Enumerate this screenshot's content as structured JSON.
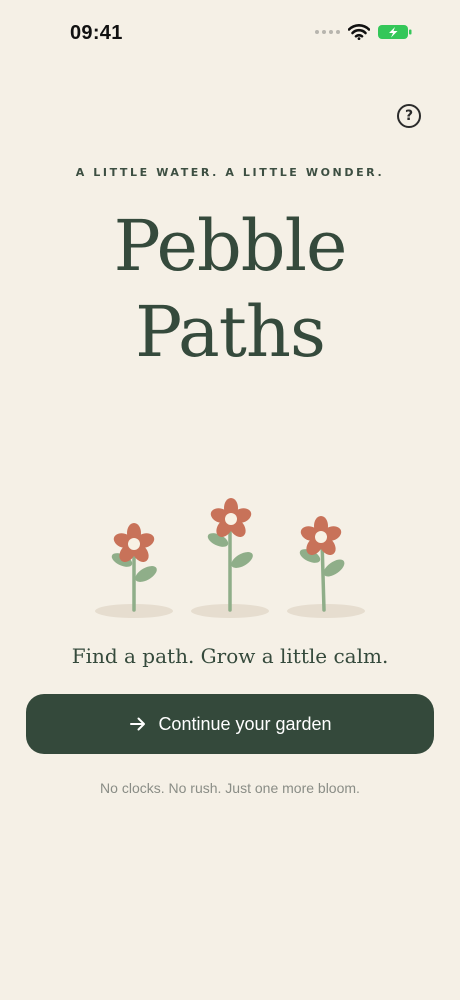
{
  "status_bar": {
    "time": "09:41",
    "icons": [
      "signal-dots-icon",
      "wifi-icon",
      "battery-charging-icon"
    ],
    "battery_color": "#34c759"
  },
  "help": {
    "label": "?"
  },
  "tagline": "A LITTLE WATER. A LITTLE WONDER.",
  "title": {
    "line1": "Pebble",
    "line2": "Paths"
  },
  "subtitle": "Find a path. Grow a little calm.",
  "primary_button": {
    "label": "Continue your garden",
    "icon": "arrow-right-icon"
  },
  "footnote": "No clocks. No rush. Just one more bloom.",
  "colors": {
    "background": "#f5f0e6",
    "accent": "#34493b",
    "petal": "#c87259",
    "leaf": "#8fae89",
    "shadow": "#e6ddcf"
  }
}
